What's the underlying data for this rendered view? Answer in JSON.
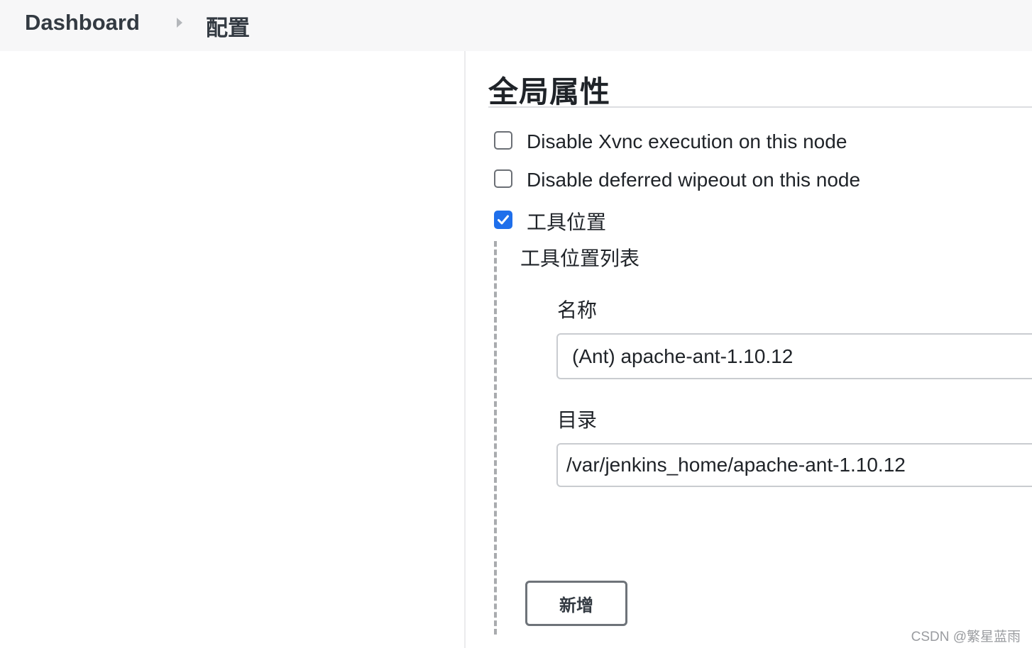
{
  "breadcrumb": {
    "home": "Dashboard",
    "current": "配置"
  },
  "section": {
    "title": "全局属性"
  },
  "options": [
    {
      "label": "Disable Xvnc execution on this node",
      "checked": false
    },
    {
      "label": "Disable deferred wipeout on this node",
      "checked": false
    },
    {
      "label": "工具位置",
      "checked": true
    }
  ],
  "tool_locations": {
    "title": "工具位置列表",
    "name_label": "名称",
    "name_value": "(Ant) apache-ant-1.10.12",
    "dir_label": "目录",
    "dir_value": "/var/jenkins_home/apache-ant-1.10.12",
    "add_button": "新增"
  },
  "watermark": "CSDN @繁星蓝雨",
  "colors": {
    "accent": "#1f6feb",
    "breadcrumb_bg": "#f7f7f8"
  }
}
